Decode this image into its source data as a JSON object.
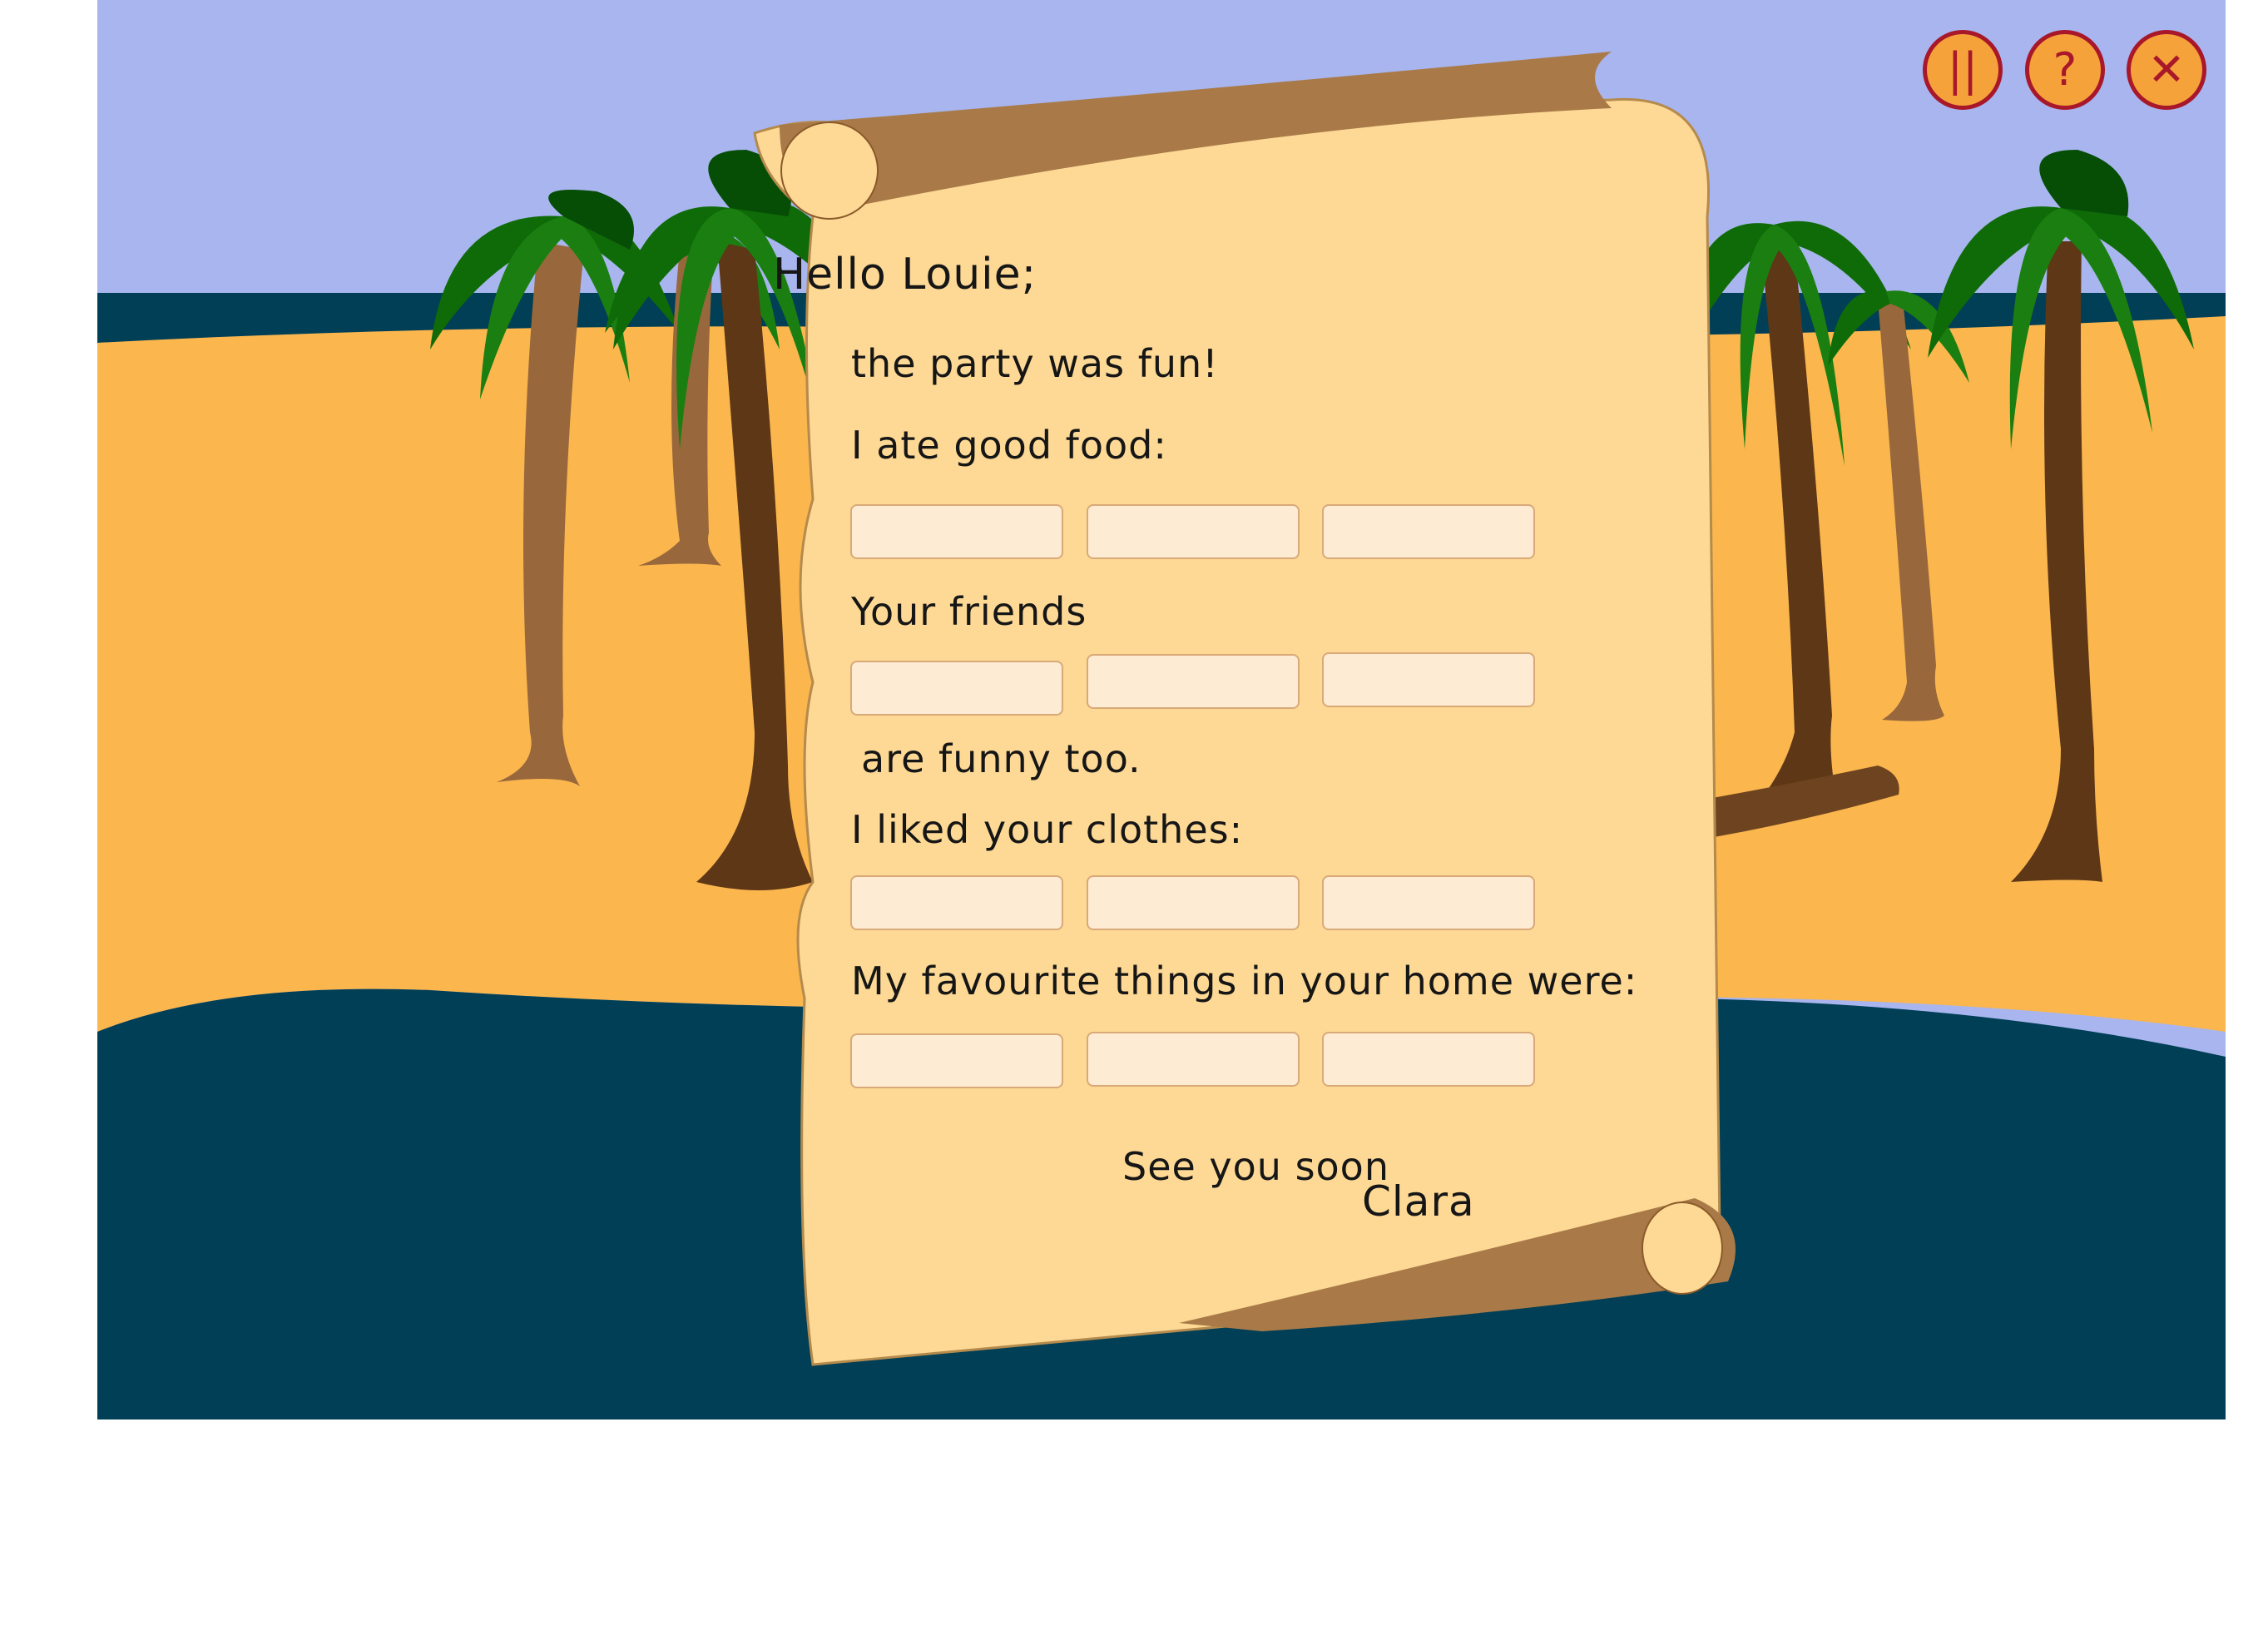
{
  "letter": {
    "greeting": "Hello Louie;",
    "line_party": "the party was fun!",
    "line_food": "I ate good food:",
    "line_friends": "Your friends",
    "line_funny": "are funny too.",
    "line_clothes": "I liked your clothes:",
    "line_things": "My favourite things in your home were:",
    "closing": "See you soon",
    "signature": "Clara"
  },
  "controls": {
    "pause_icon": "pause-icon",
    "help_icon": "question-mark-icon",
    "close_icon": "close-icon",
    "pause_symbol": "||",
    "help_symbol": "?",
    "close_symbol": "✕"
  },
  "answer_slots": {
    "food": [
      "",
      "",
      ""
    ],
    "friends": [
      "",
      "",
      ""
    ],
    "clothes": [
      "",
      "",
      ""
    ],
    "things": [
      "",
      "",
      ""
    ]
  },
  "colors": {
    "sky": "#a8b5ee",
    "sand": "#fbb64e",
    "sea": "#003f56",
    "parchment": "#fdd995",
    "scroll_roll": "#a97a48",
    "button_fill": "#f5a23a",
    "button_border": "#a8172a",
    "slot_fill": "#fdebd4"
  }
}
